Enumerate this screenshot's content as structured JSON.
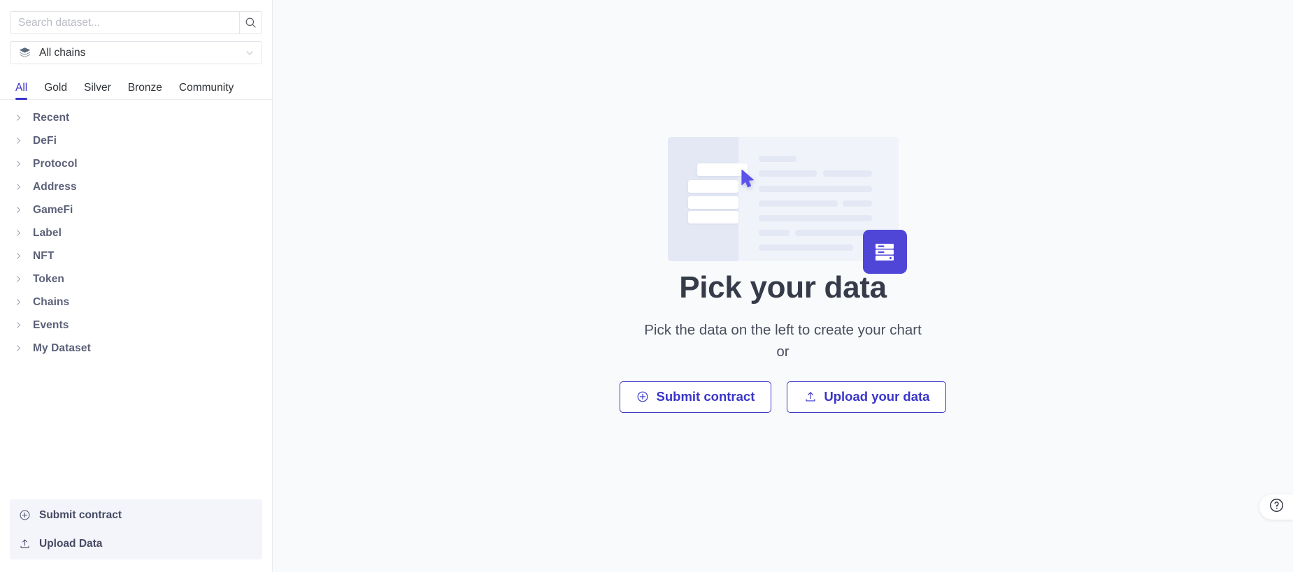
{
  "sidebar": {
    "search": {
      "placeholder": "Search dataset...",
      "value": "",
      "icon": "search-icon"
    },
    "chain_select": {
      "icon": "layers-stack-icon",
      "label": "All chains",
      "caret": "chevron-down-icon"
    },
    "tabs": [
      {
        "label": "All",
        "active": true
      },
      {
        "label": "Gold",
        "active": false
      },
      {
        "label": "Silver",
        "active": false
      },
      {
        "label": "Bronze",
        "active": false
      },
      {
        "label": "Community",
        "active": false
      }
    ],
    "tree": [
      {
        "label": "Recent",
        "chevron": "chevron-right-icon"
      },
      {
        "label": "DeFi",
        "chevron": "chevron-right-icon"
      },
      {
        "label": "Protocol",
        "chevron": "chevron-right-icon"
      },
      {
        "label": "Address",
        "chevron": "chevron-right-icon"
      },
      {
        "label": "GameFi",
        "chevron": "chevron-right-icon"
      },
      {
        "label": "Label",
        "chevron": "chevron-right-icon"
      },
      {
        "label": "NFT",
        "chevron": "chevron-right-icon"
      },
      {
        "label": "Token",
        "chevron": "chevron-right-icon"
      },
      {
        "label": "Chains",
        "chevron": "chevron-right-icon"
      },
      {
        "label": "Events",
        "chevron": "chevron-right-icon"
      },
      {
        "label": "My Dataset",
        "chevron": "chevron-right-icon"
      }
    ],
    "actions": [
      {
        "label": "Submit contract",
        "icon": "plus-circle-icon"
      },
      {
        "label": "Upload Data",
        "icon": "upload-icon"
      }
    ]
  },
  "main": {
    "illustration": "pick-data-illustration",
    "title": "Pick your data",
    "subtitle_line1": "Pick the data on the left to create your chart",
    "subtitle_line2": "or",
    "buttons": [
      {
        "label": "Submit contract",
        "icon": "plus-circle-icon"
      },
      {
        "label": "Upload your data",
        "icon": "upload-icon"
      }
    ]
  },
  "help": {
    "icon": "question-mark-circle-icon",
    "label": "?"
  },
  "colors": {
    "accent": "#3a34c9",
    "accent_fill": "#4f46d8",
    "sidebar_bg": "#ffffff",
    "main_bg": "#f9fafc",
    "action_panel_bg": "#f4f4fb",
    "tree_text": "#5b6078",
    "title_text": "#363b49"
  }
}
